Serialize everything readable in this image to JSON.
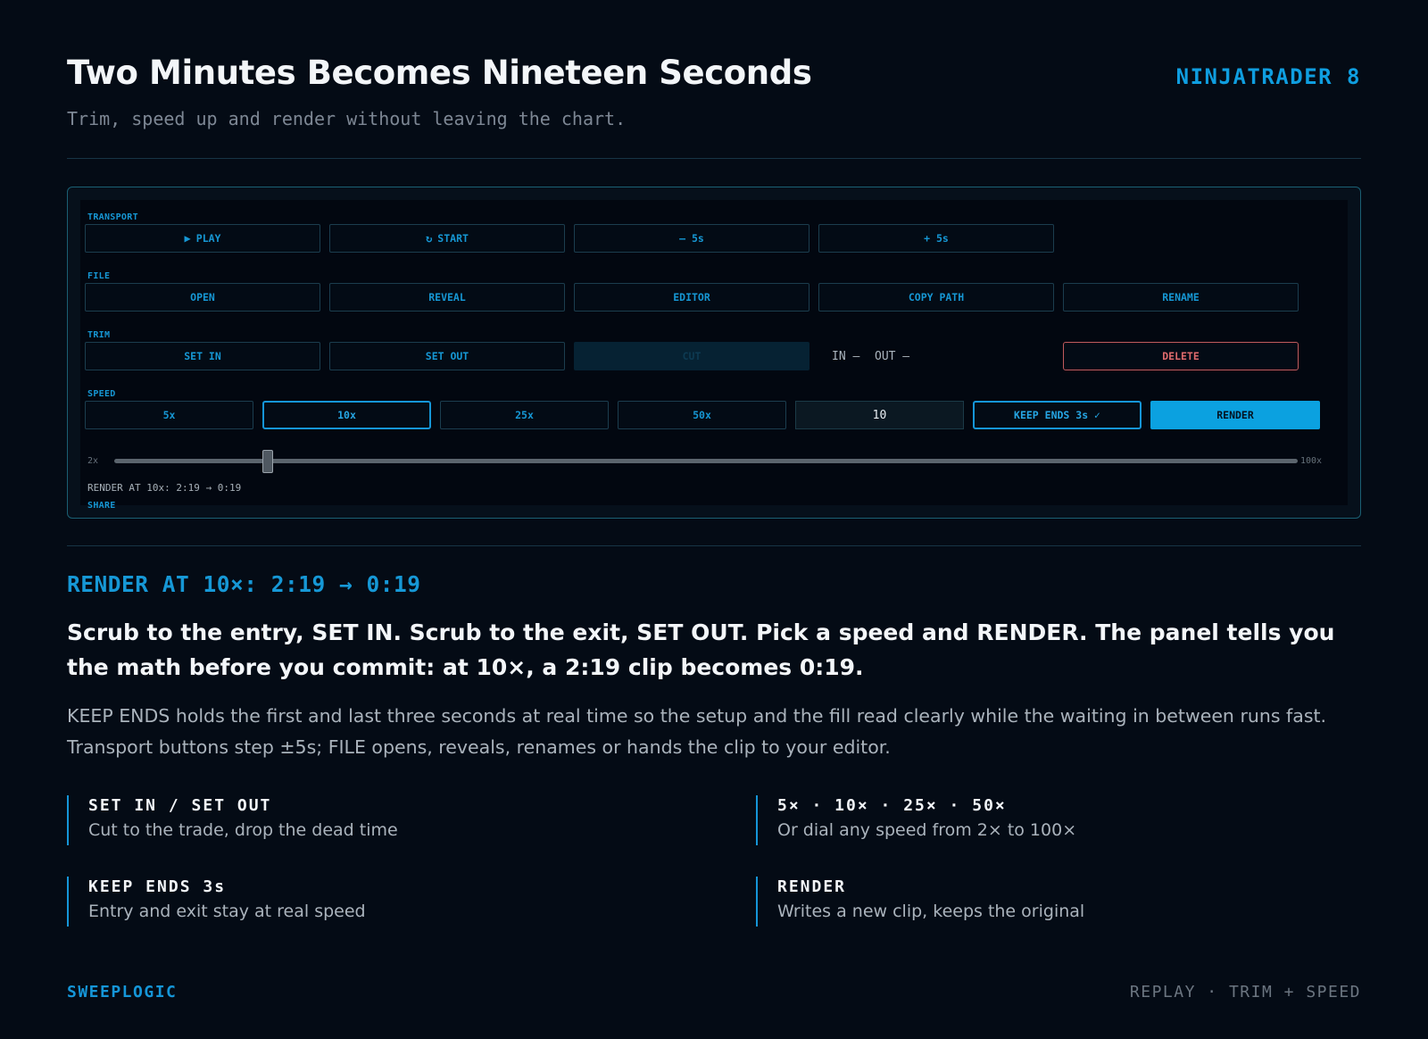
{
  "header": {
    "title": "Two Minutes Becomes Nineteen Seconds",
    "subtitle": "Trim, speed up and render without leaving the chart.",
    "brand": "NINJATRADER 8"
  },
  "panel": {
    "transport": {
      "label": "TRANSPORT",
      "buttons": [
        {
          "icon": "play-icon",
          "glyph": "▶",
          "label": "PLAY"
        },
        {
          "icon": "restart-icon",
          "glyph": "↻",
          "label": "START"
        },
        {
          "label": "– 5s"
        },
        {
          "label": "+ 5s"
        }
      ]
    },
    "file": {
      "label": "FILE",
      "buttons": [
        "OPEN",
        "REVEAL",
        "EDITOR",
        "COPY PATH",
        "RENAME"
      ]
    },
    "trim": {
      "label": "TRIM",
      "set_in": "SET IN",
      "set_out": "SET OUT",
      "cut": "CUT",
      "in_text": "IN –",
      "out_text": "OUT –",
      "delete": "DELETE"
    },
    "speed": {
      "label": "SPEED",
      "presets": [
        "5x",
        "10x",
        "25x",
        "50x"
      ],
      "selected": "10x",
      "input_value": "10",
      "keep_ends": "KEEP ENDS 3s ✓",
      "render": "RENDER",
      "slider_min": "2x",
      "slider_max": "100x",
      "slider_min_value": 2,
      "slider_max_value": 100,
      "slider_value": 10
    },
    "render_info": "RENDER AT 10x: 2:19 → 0:19",
    "share_label": "SHARE"
  },
  "body": {
    "render_heading": "RENDER AT 10×: 2:19 → 0:19",
    "lead": "Scrub to the entry, SET IN. Scrub to the exit, SET OUT. Pick a speed and RENDER. The panel tells you the math before you commit: at 10×, a 2:19 clip becomes 0:19.",
    "desc": "KEEP ENDS holds the first and last three seconds at real time so the setup and the fill read clearly while the waiting in between runs fast. Transport buttons step ±5s; FILE opens, reveals, renames or hands the clip to your editor."
  },
  "features": [
    {
      "title": "SET IN / SET OUT",
      "desc": "Cut to the trade, drop the dead time"
    },
    {
      "title": "5× · 10× · 25× · 50×",
      "desc": "Or dial any speed from 2× to 100×"
    },
    {
      "title": "KEEP ENDS 3s",
      "desc": "Entry and exit stay at real speed"
    },
    {
      "title": "RENDER",
      "desc": "Writes a new clip, keeps the original"
    }
  ],
  "footer": {
    "left": "SWEEPLOGIC",
    "right": "REPLAY · TRIM + SPEED"
  },
  "colors": {
    "background": "#040b15",
    "accent": "#1596d8",
    "primary_button": "#0ba1e0",
    "danger": "#de6a6c"
  }
}
